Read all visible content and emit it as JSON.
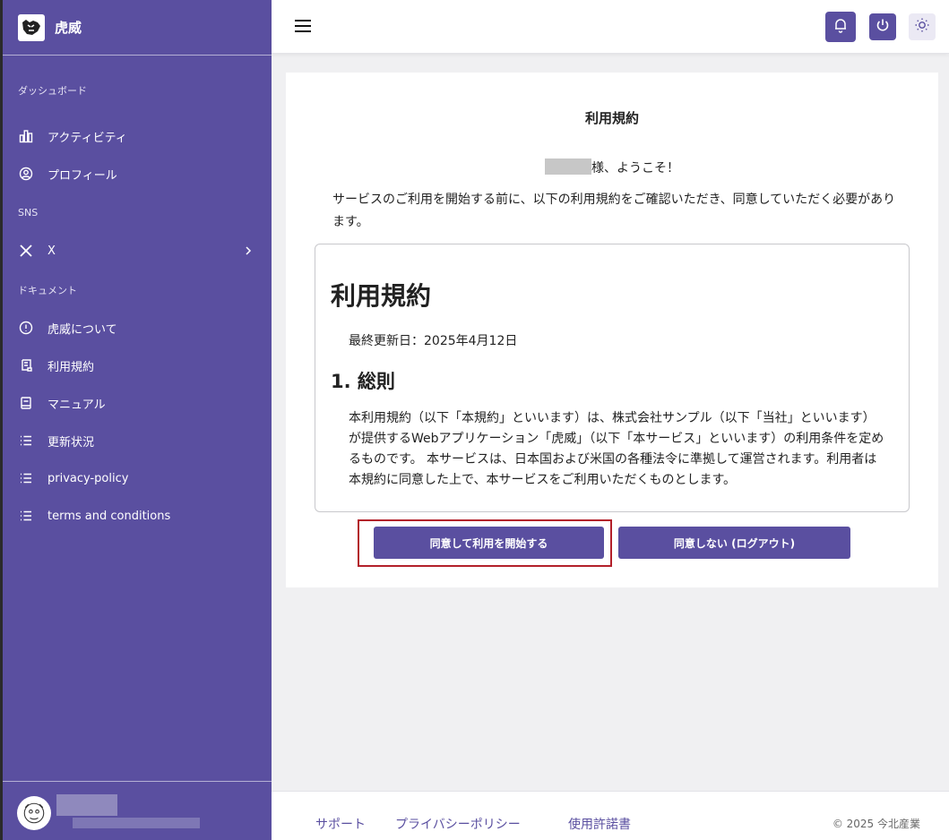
{
  "brand": {
    "name": "虎威"
  },
  "sidebar": {
    "sections": [
      {
        "label": "ダッシュボード"
      },
      {
        "label": "SNS"
      },
      {
        "label": "ドキュメント"
      }
    ],
    "items": [
      {
        "label": "アクティビティ",
        "icon": "bar-chart-icon"
      },
      {
        "label": "プロフィール",
        "icon": "user-circle-icon"
      },
      {
        "label": "X",
        "icon": "x-logo-icon"
      },
      {
        "label": "虎威について",
        "icon": "info-icon"
      },
      {
        "label": "利用規約",
        "icon": "scroll-icon"
      },
      {
        "label": "マニュアル",
        "icon": "book-icon"
      },
      {
        "label": "更新状況",
        "icon": "list-icon"
      },
      {
        "label": "privacy-policy",
        "icon": "list-icon"
      },
      {
        "label": "terms and conditions",
        "icon": "list-icon"
      }
    ]
  },
  "main": {
    "title": "利用規約",
    "welcome_suffix": "様、ようこそ！",
    "intro": "サービスのご利用を開始する前に、以下の利用規約をご確認いただき、同意していただく必要があります。",
    "terms": {
      "heading": "利用規約",
      "updated": "最終更新日：2025年4月12日",
      "section1_title": "1. 総則",
      "section1_body": "本利用規約（以下「本規約」といいます）は、株式会社サンプル（以下「当社」といいます）が提供するWebアプリケーション「虎威」（以下「本サービス」といいます）の利用条件を定めるものです。 本サービスは、日本国および米国の各種法令に準拠して運営されます。利用者は本規約に同意した上で、本サービスをご利用いただくものとします。"
    },
    "agree_button": "同意して利用を開始する",
    "decline_button": "同意しない (ログアウト)"
  },
  "footer": {
    "links": [
      "サポート",
      "プライバシーポリシー",
      "使用許諾書"
    ],
    "copyright": "© 2025 今北産業"
  },
  "colors": {
    "accent": "#5a4fa0",
    "highlight_border": "#b3202a"
  }
}
